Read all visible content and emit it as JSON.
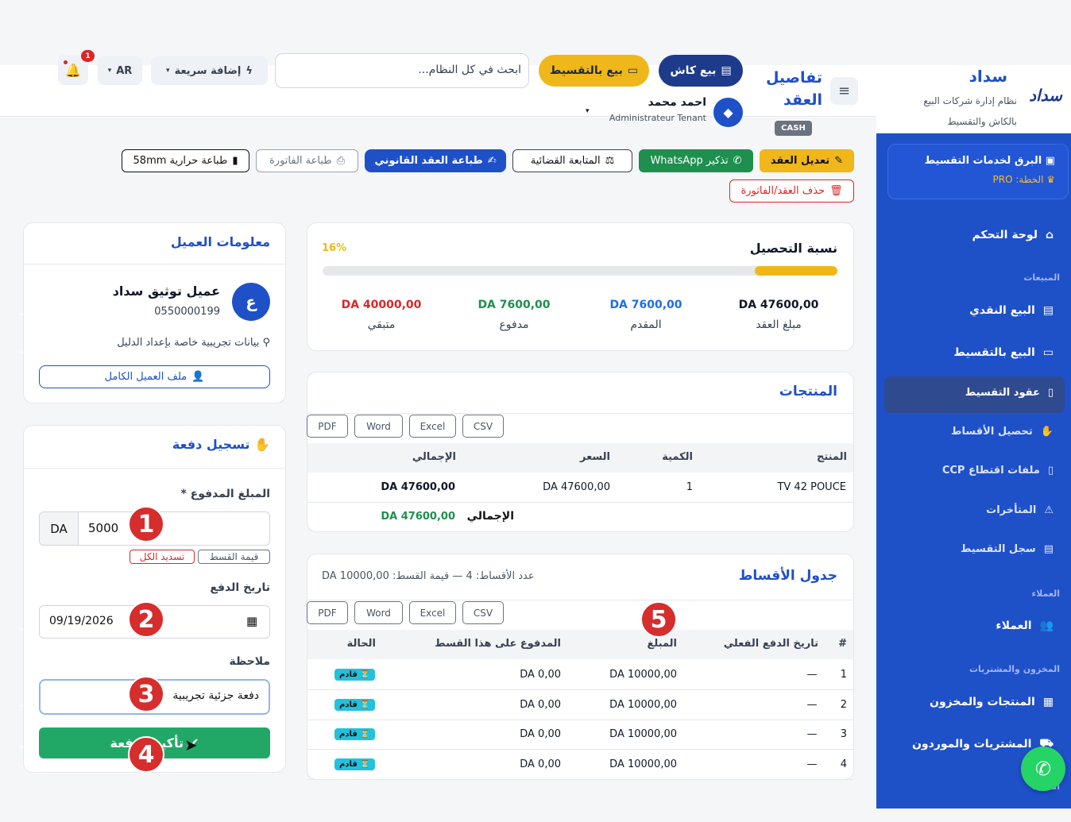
{
  "sidebar": {
    "brand": "سداد",
    "brand_subtitle": "نظام إدارة شركات البيع بالكاش والتقسيط",
    "logo_text": "سداد",
    "tenant_name": "البرق لخدمات التقسيط",
    "plan": "الخطة: PRO",
    "dashboard": "لوحة التحكم",
    "section_sales": "المبيعات",
    "cash_sale": "البيع النقدي",
    "installment_sale": "البيع بالتقسيط",
    "installment_contracts": "عقود التقسيط",
    "collect_installments": "تحصيل الأقساط",
    "ccp_files": "ملفات اقتطاع CCP",
    "late": "المتأخرات",
    "installment_log": "سجل التقسيط",
    "section_clients": "العملاء",
    "clients": "العملاء",
    "section_stock": "المخزون والمشتريات",
    "products_stock": "المنتجات والمخزون",
    "purchases": "المشتريات والموردون",
    "section_more": "المالية"
  },
  "header": {
    "page_title": "تفاصيل العقد",
    "cash_badge": "CASH",
    "cash_sale_btn": "بيع كاش",
    "installment_btn": "بيع بالتقسيط",
    "search_placeholder": "ابحث في كل النظام...",
    "quick_add": "إضافة سريعة",
    "lang": "AR",
    "notif_count": "1",
    "user_name": "احمد محمد",
    "user_role": "Administrateur Tenant"
  },
  "actions": {
    "edit": "تعديل العقد",
    "whatsapp": "تذكير WhatsApp",
    "legal": "المتابعة القضائية",
    "print_legal": "طباعة العقد القانوني",
    "print_invoice": "طباعة الفاتورة",
    "print_thermal": "طباعة حرارية 58mm",
    "delete": "حذف العقد/الفاتورة"
  },
  "collection": {
    "title": "نسبة التحصيل",
    "percent_label": "16%",
    "percent": 16,
    "contract_amount": "DA 47600,00",
    "contract_label": "مبلغ العقد",
    "advance": "DA 7600,00",
    "advance_label": "المقدم",
    "paid": "DA 7600,00",
    "paid_label": "مدفوع",
    "remaining": "DA 40000,00",
    "remaining_label": "متبقي"
  },
  "products": {
    "title": "المنتجات",
    "exports": [
      "CSV",
      "Excel",
      "Word",
      "PDF"
    ],
    "headers": [
      "المنتج",
      "الكمية",
      "السعر",
      "الإجمالي"
    ],
    "row": [
      "TV 42 POUCE",
      "1",
      "DA 47600,00",
      "DA 47600,00"
    ],
    "total_label": "الإجمالي",
    "total_value": "DA 47600,00"
  },
  "schedule": {
    "title": "جدول الأقساط",
    "summary": "عدد الأقساط: 4 — قيمة القسط: DA 10000,00",
    "exports": [
      "CSV",
      "Excel",
      "Word",
      "PDF"
    ],
    "headers": [
      "#",
      "تاريخ الدفع الفعلي",
      "المبلغ",
      "المدفوع على هذا القسط",
      "الحالة"
    ],
    "rows": [
      {
        "n": "1",
        "date": "—",
        "amount": "DA 10000,00",
        "paid": "DA 0,00",
        "status": "⏳ قادم"
      },
      {
        "n": "2",
        "date": "—",
        "amount": "DA 10000,00",
        "paid": "DA 0,00",
        "status": "⏳ قادم"
      },
      {
        "n": "3",
        "date": "—",
        "amount": "DA 10000,00",
        "paid": "DA 0,00",
        "status": "⏳ قادم"
      },
      {
        "n": "4",
        "date": "—",
        "amount": "DA 10000,00",
        "paid": "DA 0,00",
        "status": "⏳ قادم"
      }
    ]
  },
  "client": {
    "title": "معلومات العميل",
    "avatar_letter": "ع",
    "name": "عميل توثيق سداد",
    "phone": "0550000199",
    "address": "بيانات تجريبية خاصة بإعداد الدليل",
    "profile_btn": "ملف العميل الكامل"
  },
  "payment": {
    "title": "تسجيل دفعة",
    "amount_label": "المبلغ المدفوع *",
    "currency": "DA",
    "amount_value": "5000",
    "installment_value_btn": "قيمة القسط",
    "pay_all_btn": "تسديد الكل",
    "date_label": "تاريخ الدفع",
    "date_value": "09/19/2026",
    "note_label": "ملاحظة",
    "note_value": "دفعة جزئية تجريبية",
    "confirm_btn": "تأكيد الدفعة"
  },
  "markers": [
    "1",
    "2",
    "3",
    "4",
    "5"
  ]
}
